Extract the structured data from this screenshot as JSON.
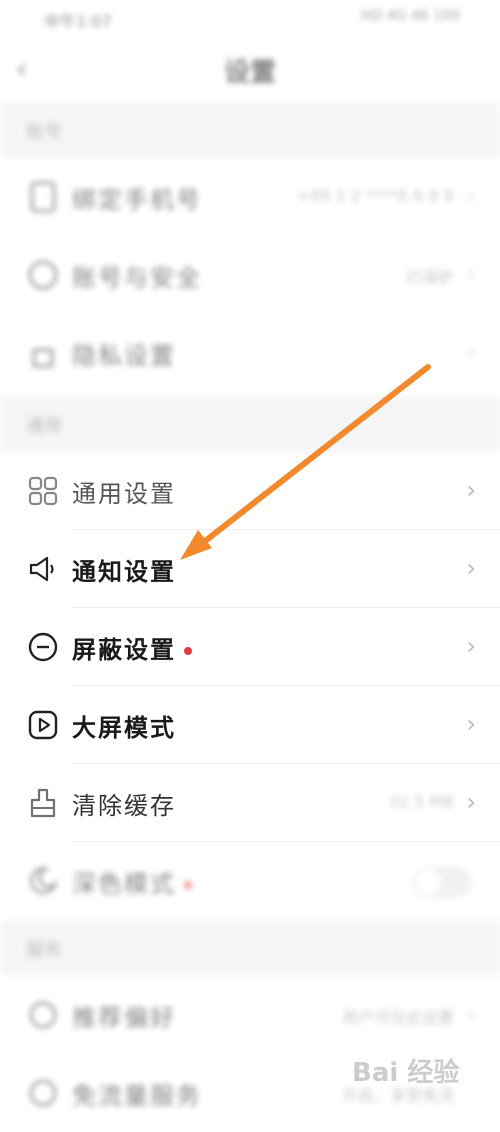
{
  "status_bar": {
    "time": "中午1:07",
    "right_text": "HD 4G 46 100"
  },
  "header": {
    "back_icon": "chevron-left-icon",
    "title": "设置"
  },
  "sections": {
    "account": {
      "label": "账号"
    },
    "general": {
      "label": "通用"
    },
    "about": {
      "label": "服务"
    }
  },
  "account_items": [
    {
      "label": "绑定手机号",
      "value": "+86 1 2 ****6 6 8 8",
      "icon": "phone-icon"
    },
    {
      "label": "账号与安全",
      "value": "已保护",
      "icon": "shield-icon"
    },
    {
      "label": "隐私设置",
      "value": "",
      "icon": "lock-icon"
    }
  ],
  "general_items": [
    {
      "label": "通用设置",
      "icon": "grid-icon"
    },
    {
      "label": "通知设置",
      "icon": "speaker-icon"
    },
    {
      "label": "屏蔽设置",
      "icon": "minus-circle-icon",
      "badge": true
    },
    {
      "label": "大屏模式",
      "icon": "play-icon"
    },
    {
      "label": "清除缓存",
      "value": "32.5 MB",
      "icon": "brush-icon"
    },
    {
      "label": "深色模式",
      "icon": "moon-icon",
      "badge": true
    }
  ],
  "about_items": [
    {
      "label": "推荐偏好",
      "value": "用户可在此设置"
    },
    {
      "label": "免流量服务",
      "value": "开启，享受免流"
    }
  ],
  "watermark": "Bai 经验",
  "colors": {
    "arrow": "#f28a2d",
    "badge": "#e23b3b"
  }
}
